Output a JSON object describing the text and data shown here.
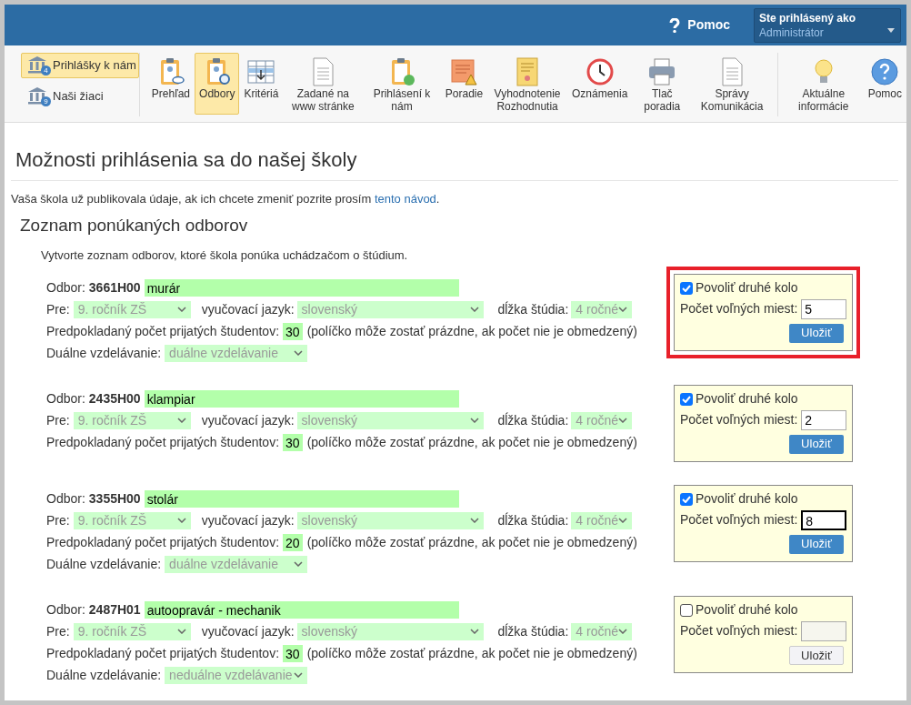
{
  "header": {
    "help_label": "Pomoc",
    "user_caption": "Ste prihlásený ako",
    "user_name": "Administrátor"
  },
  "side_nav": [
    {
      "label": "Prihlášky k nám",
      "badge": "4",
      "selected": true
    },
    {
      "label": "Naši žiaci",
      "badge": "9",
      "selected": false
    }
  ],
  "toolbar": [
    {
      "kind": "overview",
      "label": "Prehľad",
      "selected": false
    },
    {
      "kind": "fields",
      "label": "Odbory",
      "selected": true
    },
    {
      "kind": "criteria",
      "label": "Kritériá",
      "selected": false
    },
    {
      "kind": "document",
      "label": "Zadané na www stránke",
      "selected": false
    },
    {
      "kind": "applied",
      "label": "Prihlásení k nám",
      "selected": false
    },
    {
      "kind": "ranking",
      "label": "Poradie",
      "selected": false
    },
    {
      "kind": "certificate",
      "label": "Vyhodnotenie Rozhodnutia",
      "selected": false
    },
    {
      "kind": "clock",
      "label": "Oznámenia",
      "selected": false
    },
    {
      "kind": "printer",
      "label": "Tlač poradia",
      "selected": false
    },
    {
      "kind": "document",
      "label": "Správy Komunikácia",
      "selected": false
    },
    {
      "kind": "divider"
    },
    {
      "kind": "bulb",
      "label": "Aktuálne informácie",
      "selected": false
    },
    {
      "kind": "help",
      "label": "Pomoc",
      "selected": false
    }
  ],
  "page_title": "Možnosti prihlásenia sa do našej školy",
  "notice": {
    "text": "Vaša škola už publikovala údaje, ak ich chcete zmeniť pozrite prosím",
    "link": "tento návod",
    "end": "."
  },
  "section_title": "Zoznam ponúkaných odborov",
  "section_intro": "Vytvorte zoznam odborov, ktoré škola ponúka uchádzačom o štúdium.",
  "programs": [
    {
      "field_label": "Odbor:",
      "code": "3661H00",
      "name": "murár",
      "for_label": "Pre:",
      "for": "9. ročník ZŠ",
      "language_label": "vyučovací jazyk:",
      "language": "slovenský",
      "duration_label": "dĺžka štúdia:",
      "duration": "4 ročné",
      "count_label": "Predpokladaný počet prijatých študentov:",
      "count": "30",
      "count_hint": "(políčko môže zostať prázdne, ak počet nie je obmedzený)",
      "dual_label": "Duálne vzdelávanie:",
      "dual": "duálne vzdelávanie",
      "second_round": {
        "checkbox_label": "Povoliť druhé kolo",
        "checked": true,
        "seats_label": "Počet voľných miest:",
        "seats": "5",
        "focused": false,
        "button": "Uložiť",
        "highlighted": true
      }
    },
    {
      "field_label": "Odbor:",
      "code": "2435H00",
      "name": "klampiar",
      "for_label": "Pre:",
      "for": "9. ročník ZŠ",
      "language_label": "vyučovací jazyk:",
      "language": "slovenský",
      "duration_label": "dĺžka štúdia:",
      "duration": "4 ročné",
      "count_label": "Predpokladaný počet prijatých študentov:",
      "count": "30",
      "count_hint": "(políčko môže zostať prázdne, ak počet nie je obmedzený)",
      "second_round": {
        "checkbox_label": "Povoliť druhé kolo",
        "checked": true,
        "seats_label": "Počet voľných miest:",
        "seats": "2",
        "focused": false,
        "button": "Uložiť",
        "highlighted": false
      }
    },
    {
      "field_label": "Odbor:",
      "code": "3355H00",
      "name": "stolár",
      "for_label": "Pre:",
      "for": "9. ročník ZŠ",
      "language_label": "vyučovací jazyk:",
      "language": "slovenský",
      "duration_label": "dĺžka štúdia:",
      "duration": "4 ročné",
      "count_label": "Predpokladaný počet prijatých študentov:",
      "count": "20",
      "count_hint": "(políčko môže zostať prázdne, ak počet nie je obmedzený)",
      "dual_label": "Duálne vzdelávanie:",
      "dual": "duálne vzdelávanie",
      "second_round": {
        "checkbox_label": "Povoliť druhé kolo",
        "checked": true,
        "seats_label": "Počet voľných miest:",
        "seats": "8",
        "focused": true,
        "button": "Uložiť",
        "highlighted": false
      }
    },
    {
      "field_label": "Odbor:",
      "code": "2487H01",
      "name": "autoopravár - mechanik",
      "for_label": "Pre:",
      "for": "9. ročník ZŠ",
      "language_label": "vyučovací jazyk:",
      "language": "slovenský",
      "duration_label": "dĺžka štúdia:",
      "duration": "4 ročné",
      "count_label": "Predpokladaný počet prijatých študentov:",
      "count": "30",
      "count_hint": "(políčko môže zostať prázdne, ak počet nie je obmedzený)",
      "dual_label": "Duálne vzdelávanie:",
      "dual": "neduálne vzdelávanie",
      "second_round": {
        "checkbox_label": "Povoliť druhé kolo",
        "checked": false,
        "seats_label": "Počet voľných miest:",
        "focused": false,
        "button": "Uložiť",
        "highlighted": false
      }
    }
  ]
}
